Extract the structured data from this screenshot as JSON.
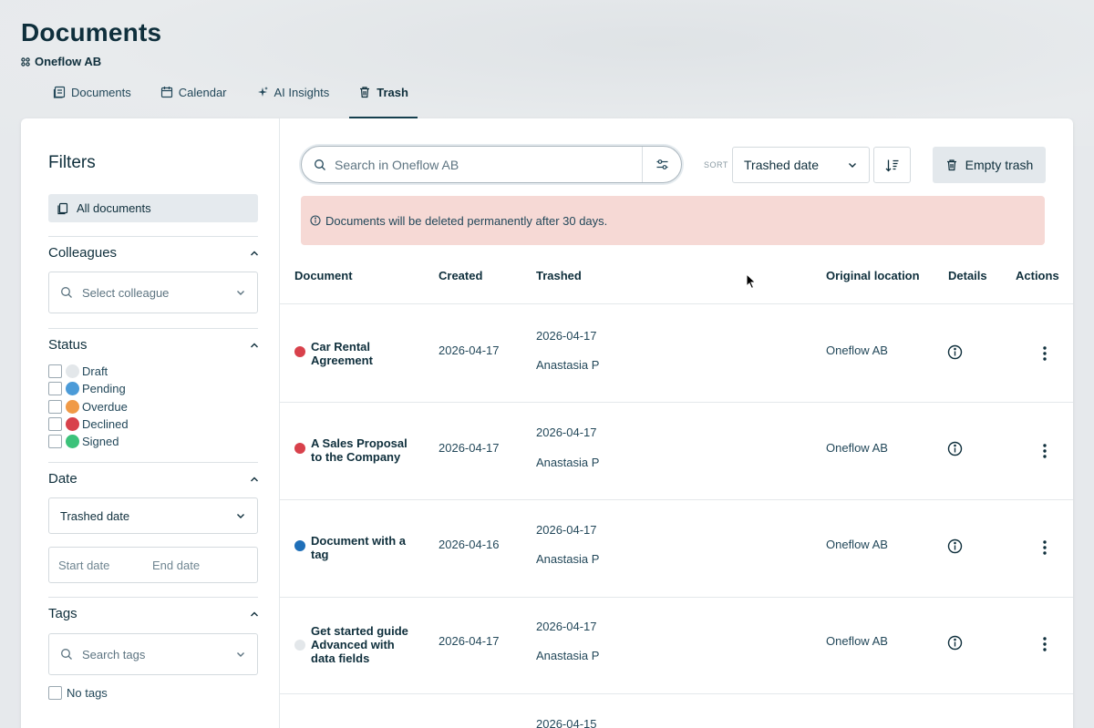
{
  "page": {
    "title": "Documents",
    "workspace": "Oneflow AB"
  },
  "tabs": [
    {
      "label": "Documents",
      "icon": "documents-icon"
    },
    {
      "label": "Calendar",
      "icon": "calendar-icon"
    },
    {
      "label": "AI Insights",
      "icon": "sparkle-icon"
    },
    {
      "label": "Trash",
      "icon": "trash-icon",
      "active": true
    }
  ],
  "filters": {
    "title": "Filters",
    "all_documents": "All documents",
    "colleagues": {
      "title": "Colleagues",
      "placeholder": "Select colleague"
    },
    "status": {
      "title": "Status",
      "items": [
        {
          "label": "Draft",
          "color": "#e3e7ea"
        },
        {
          "label": "Pending",
          "color": "#4b9bd8"
        },
        {
          "label": "Overdue",
          "color": "#f09a47"
        },
        {
          "label": "Declined",
          "color": "#d8414b"
        },
        {
          "label": "Signed",
          "color": "#3cc27a"
        }
      ]
    },
    "date": {
      "title": "Date",
      "selected": "Trashed date",
      "start_placeholder": "Start date",
      "end_placeholder": "End date"
    },
    "tags": {
      "title": "Tags",
      "placeholder": "Search tags",
      "no_tags": "No tags"
    }
  },
  "toolbar": {
    "search_placeholder": "Search in Oneflow AB",
    "sort_label": "SORT",
    "sort_selected": "Trashed date",
    "empty_trash": "Empty trash"
  },
  "notice": "Documents will be deleted permanently after 30 days.",
  "table": {
    "headers": {
      "document": "Document",
      "created": "Created",
      "trashed": "Trashed",
      "original_location": "Original location",
      "details": "Details",
      "actions": "Actions"
    },
    "rows": [
      {
        "name": "Car Rental Agreement",
        "status_color": "#d8414b",
        "created": "2026-04-17",
        "trashed_date": "2026-04-17",
        "trashed_by": "Anastasia P",
        "location": "Oneflow AB"
      },
      {
        "name": "A Sales Proposal to the Company",
        "status_color": "#d8414b",
        "created": "2026-04-17",
        "trashed_date": "2026-04-17",
        "trashed_by": "Anastasia P",
        "location": "Oneflow AB"
      },
      {
        "name": "Document with a tag",
        "status_color": "#1f6fb8",
        "created": "2026-04-16",
        "trashed_date": "2026-04-17",
        "trashed_by": "Anastasia P",
        "location": "Oneflow AB"
      },
      {
        "name": "Get started guide Advanced with data fields",
        "status_color": "#e3e7ea",
        "created": "2026-04-17",
        "trashed_date": "2026-04-17",
        "trashed_by": "Anastasia P",
        "location": "Oneflow AB"
      },
      {
        "name": "",
        "status_color": "",
        "created": "",
        "trashed_date": "2026-04-15",
        "trashed_by": "",
        "location": ""
      }
    ]
  }
}
